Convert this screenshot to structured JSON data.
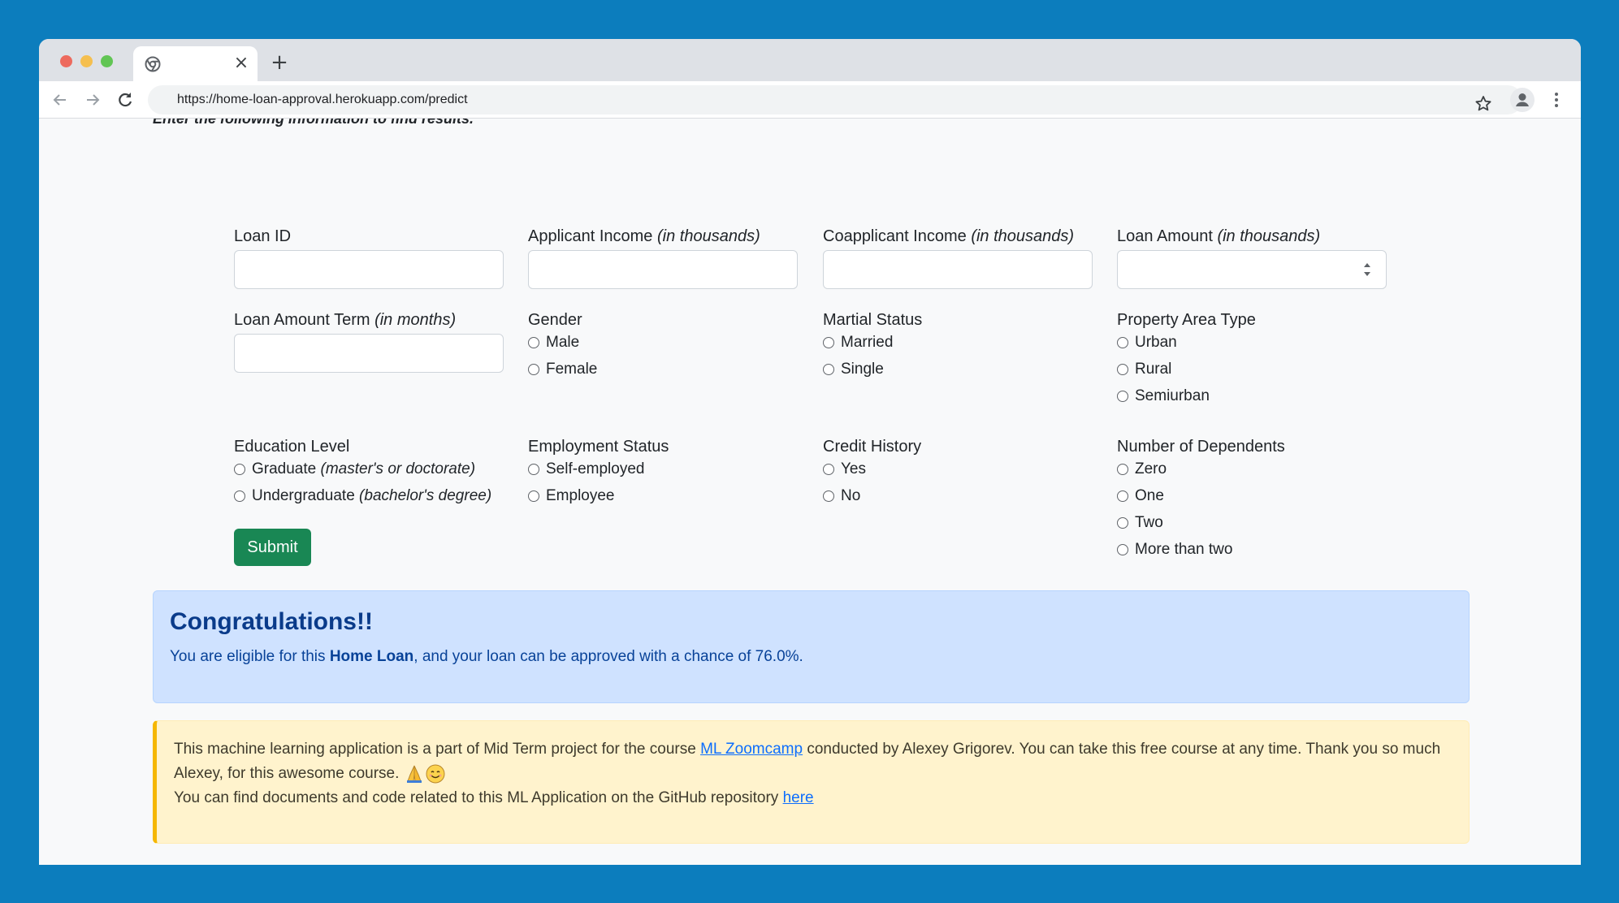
{
  "browser": {
    "url": "https://home-loan-approval.herokuapp.com/predict",
    "tab_close": "×",
    "new_tab": "+"
  },
  "page": {
    "intro": "Enter the following information to find results.",
    "fields": {
      "loan_id": {
        "label": "Loan ID",
        "hint": ""
      },
      "applicant_income": {
        "label": "Applicant Income ",
        "hint": "(in thousands)"
      },
      "coapplicant_income": {
        "label": "Coapplicant Income ",
        "hint": "(in thousands)"
      },
      "loan_amount": {
        "label": "Loan Amount ",
        "hint": "(in thousands)"
      },
      "loan_amount_term": {
        "label": "Loan Amount Term ",
        "hint": "(in months)"
      }
    },
    "gender": {
      "label": "Gender",
      "options": [
        "Male",
        "Female"
      ]
    },
    "martial_status": {
      "label": "Martial Status",
      "options": [
        "Married",
        "Single"
      ]
    },
    "property_area": {
      "label": "Property Area Type",
      "options": [
        "Urban",
        "Rural",
        "Semiurban"
      ]
    },
    "education": {
      "label": "Education Level",
      "options": [
        {
          "text": "Graduate ",
          "hint": "(master's or doctorate)"
        },
        {
          "text": "Undergraduate ",
          "hint": "(bachelor's degree)"
        }
      ]
    },
    "employment": {
      "label": "Employment Status",
      "options": [
        "Self-employed",
        "Employee"
      ]
    },
    "credit_history": {
      "label": "Credit History",
      "options": [
        "Yes",
        "No"
      ]
    },
    "dependents": {
      "label": "Number of Dependents",
      "options": [
        "Zero",
        "One",
        "Two",
        "More than two"
      ]
    },
    "submit_label": "Submit"
  },
  "result": {
    "title": "Congratulations!!",
    "body_prefix": "You are eligible for this ",
    "body_strong": "Home Loan",
    "body_suffix": ", and your loan can be approved with a chance of 76.0%."
  },
  "footer_note": {
    "line1_prefix": "This machine learning application is a part of Mid Term project for the course ",
    "link1": "ML Zoomcamp",
    "line1_suffix": " conducted by Alexey Grigorev. You can take this free course at any time. Thank you so much Alexey, for this awesome course. ",
    "emoji_names": [
      "folded-hands-emoji",
      "smiling-face-emoji"
    ],
    "line2_prefix": "You can find documents and code related to this ML Application on the GitHub repository ",
    "link2": "here"
  }
}
